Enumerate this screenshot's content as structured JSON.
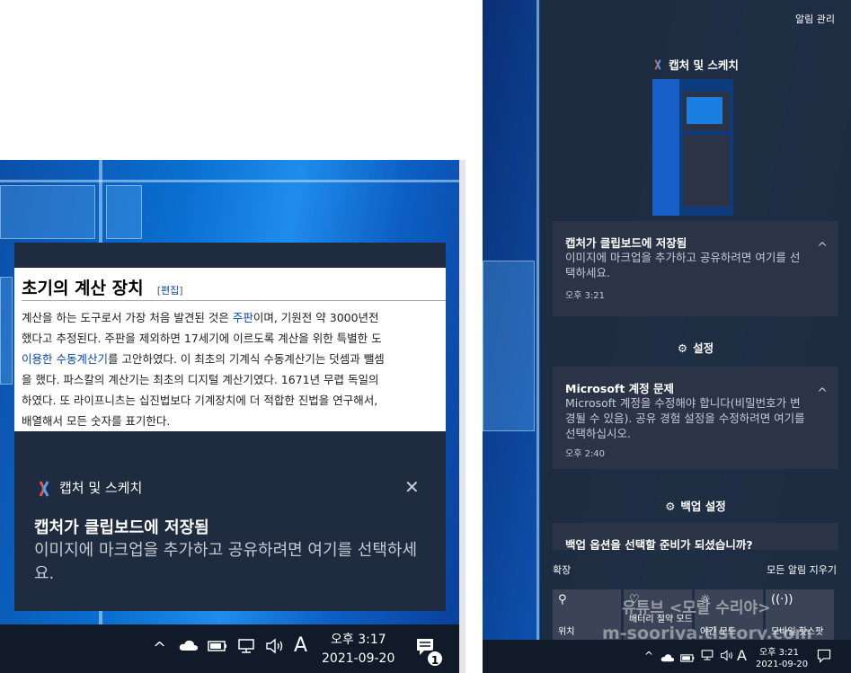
{
  "left": {
    "wiki": {
      "title": "초기의 계산 장치",
      "edit_open": "[",
      "edit_label": "편집",
      "edit_close": "]",
      "lines": [
        [
          "계산을 하는 도구로서 가장 처음 발견된 것은 ",
          "주판",
          "이며, 기원전 약 3000년전"
        ],
        [
          "했다고 추정된다. 주판을 제외하면 17세기에 이르도록 계산을 위한 특별한 도",
          "",
          ""
        ],
        [
          "",
          "이용한 수동계산기",
          "를 고안하였다. 이 최초의 기계식 수동계산기는 덧셈과 뺄셈"
        ],
        [
          "을 했다. 파스칼의 계산기는 최초의 디지털 계산기였다. 1671년 무렵 독일의 ",
          "",
          ""
        ],
        [
          "하였다. 또 라이프니츠는 십진법보다 기계장치에 더 적합한 진법을 연구해서, ",
          "",
          ""
        ],
        [
          "배열해서 모든 숫자를 표기한다.",
          "",
          ""
        ]
      ]
    },
    "toast": {
      "app_name": "캡처 및 스케치",
      "close_glyph": "✕",
      "title": "캡처가 클립보드에 저장됨",
      "body": "이미지에 마크업을 추가하고 공유하려면 여기를 선택하세요."
    },
    "taskbar": {
      "chevron": "^",
      "ime": "A",
      "time": "오후 3:17",
      "date": "2021-09-20",
      "badge": "1"
    }
  },
  "right": {
    "manage": "알림 관리",
    "groups": [
      {
        "header": "캡처 및 스케치",
        "card": {
          "title": "캡처가 클립보드에 저장됨",
          "body": "이미지에 마크업을 추가하고 공유하려면 여기를 선택하세요.",
          "time": "오후 3:21"
        }
      },
      {
        "header": "설정",
        "card": {
          "title": "Microsoft 계정 문제",
          "body": "Microsoft 계정을 수정해야 합니다(비밀번호가 변경될 수 있음). 공유 경험 설정을 수정하려면 여기를 선택하십시오.",
          "time": "오후 2:40"
        }
      },
      {
        "header": "백업 설정",
        "card": {
          "title": "백업 옵션을 선택할 준비가 되셨습니까?",
          "body": "",
          "time": ""
        }
      }
    ],
    "expand": "확장",
    "clear_all": "모든 알림 지우기",
    "quick_actions": [
      {
        "label": "위치",
        "icon": "location-icon"
      },
      {
        "label": "배터리 절약 모드",
        "icon": "battery-icon"
      },
      {
        "label": "야간 모드",
        "icon": "sun-icon"
      },
      {
        "label": "모바일 핫스팟",
        "icon": "hotspot-icon"
      }
    ],
    "watermark_line1": "유튜브 <모랄 수리야>",
    "watermark_line2": "m-sooriya.tistory.com",
    "taskbar": {
      "ime": "A",
      "time": "오후 3:21",
      "date": "2021-09-20"
    }
  },
  "colors": {
    "toast_bg": "#1f2b3f",
    "card_bg": "#2a3446",
    "taskbar_bg": "#101a29",
    "wiki_link": "#0645ad"
  }
}
